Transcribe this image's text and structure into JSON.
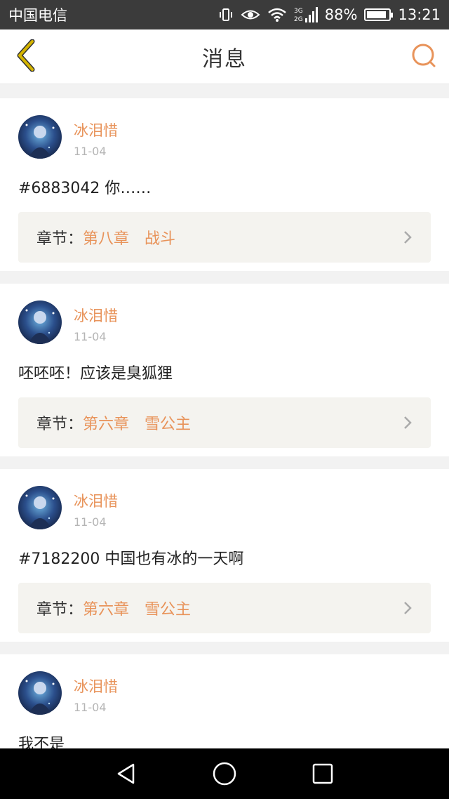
{
  "status_bar": {
    "carrier": "中国电信",
    "network": "3G 2G",
    "battery_percent": "88%",
    "battery_level": 0.88,
    "time": "13:21"
  },
  "header": {
    "title": "消息",
    "back_icon": "chevron-left-icon",
    "search_icon": "search-icon"
  },
  "colors": {
    "accent": "#e8935a",
    "back_arrow": "#d4b400"
  },
  "messages": [
    {
      "name": "冰泪惜",
      "date": "11-04",
      "content": "#6883042 你……",
      "chapter_label": "章节：",
      "chapter": "第八章　战斗"
    },
    {
      "name": "冰泪惜",
      "date": "11-04",
      "content": "呸呸呸！应该是臭狐狸",
      "chapter_label": "章节：",
      "chapter": "第六章　雪公主"
    },
    {
      "name": "冰泪惜",
      "date": "11-04",
      "content": "#7182200 中国也有冰的一天啊",
      "chapter_label": "章节：",
      "chapter": "第六章　雪公主"
    },
    {
      "name": "冰泪惜",
      "date": "11-04",
      "content": "我不是"
    }
  ],
  "nav_bar": {
    "icons": [
      "back-triangle-icon",
      "home-circle-icon",
      "recents-square-icon"
    ]
  }
}
